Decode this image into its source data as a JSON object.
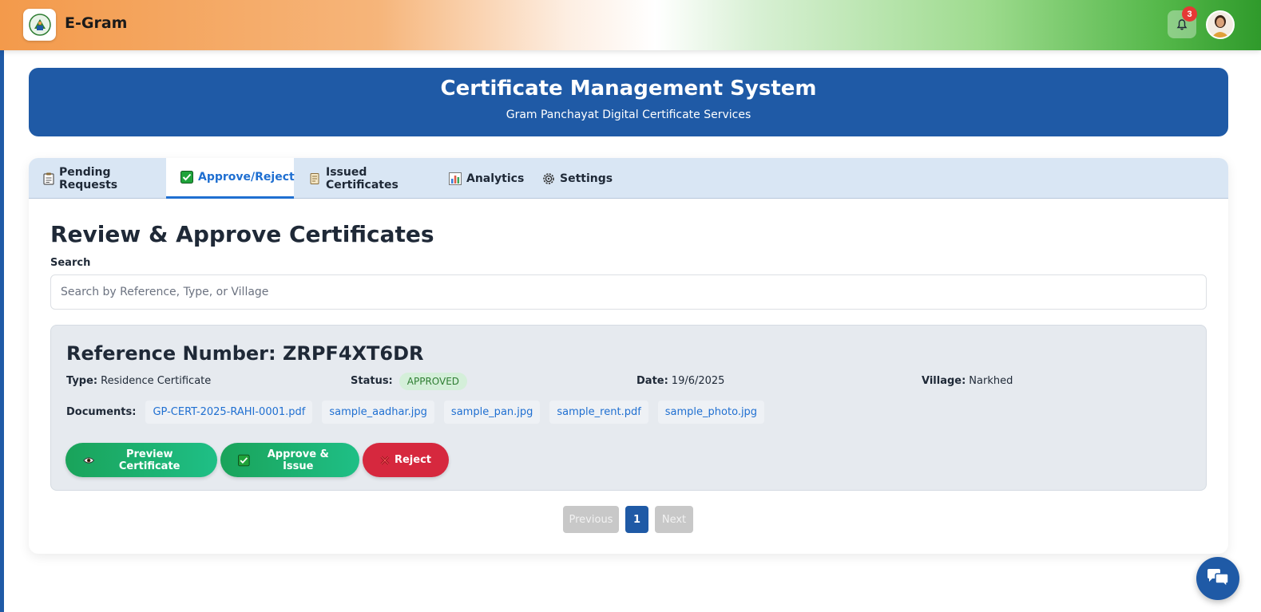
{
  "app": {
    "brand": "E-Gram"
  },
  "topbar": {
    "notification_count": "3"
  },
  "banner": {
    "title": "Certificate Management System",
    "subtitle": "Gram Panchayat Digital Certificate Services"
  },
  "tabs": [
    {
      "label": "Pending Requests",
      "icon": "clipboard-icon"
    },
    {
      "label": "Approve/Reject",
      "icon": "check-box-icon",
      "active": true
    },
    {
      "label": "Issued Certificates",
      "icon": "scroll-icon"
    },
    {
      "label": "Analytics",
      "icon": "bar-chart-icon"
    },
    {
      "label": "Settings",
      "icon": "gear-icon"
    }
  ],
  "main": {
    "title": "Review & Approve Certificates",
    "search_label": "Search",
    "search_placeholder": "Search by Reference, Type, or Village",
    "search_value": ""
  },
  "request": {
    "reference": "Reference Number: ZRPF4XT6DR",
    "type_label": "Type:",
    "type_value": "Residence Certificate",
    "status_label": "Status:",
    "status_value": "APPROVED",
    "date_label": "Date:",
    "date_value": "19/6/2025",
    "village_label": "Village:",
    "village_value": "Narkhed",
    "documents_label": "Documents:",
    "documents": [
      "GP-CERT-2025-RAHI-0001.pdf",
      "sample_aadhar.jpg",
      "sample_pan.jpg",
      "sample_rent.pdf",
      "sample_photo.jpg"
    ],
    "actions": {
      "preview": "Preview Certificate",
      "approve": "Approve & Issue",
      "reject": "Reject"
    }
  },
  "pagination": {
    "previous": "Previous",
    "current": "1",
    "next": "Next"
  },
  "colors": {
    "primary": "#1f5aa6",
    "success": "#1aa35a",
    "danger": "#d6283e",
    "link": "#1f6fd1"
  }
}
